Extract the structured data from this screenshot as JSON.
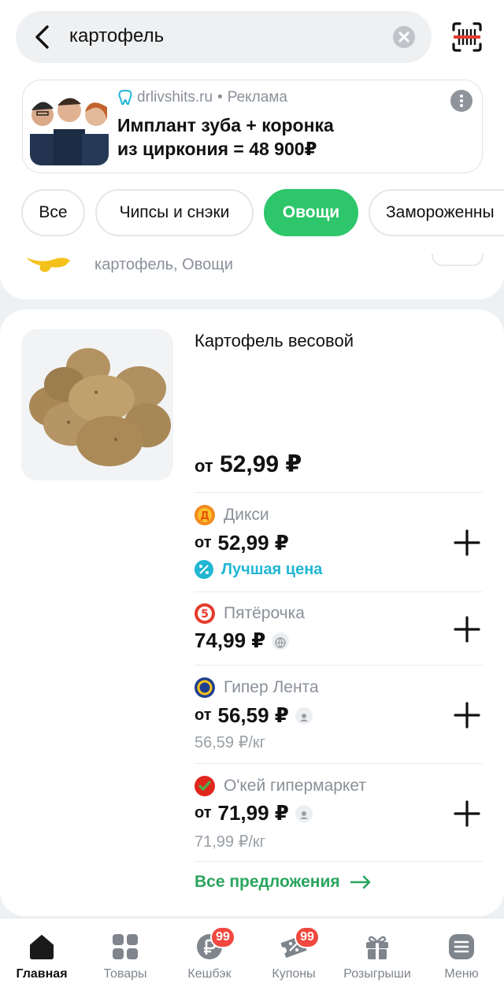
{
  "search": {
    "query": "картофель"
  },
  "ad": {
    "source": "drlivshits.ru",
    "separator": "•",
    "label": "Реклама",
    "title_line1": "Имплант зуба + коронка",
    "title_line2": "из циркония = 48 900₽"
  },
  "chips": [
    {
      "label": "Все",
      "active": false
    },
    {
      "label": "Чипсы и снэки",
      "active": false
    },
    {
      "label": "Овощи",
      "active": true
    },
    {
      "label": "Замороженны",
      "active": false
    }
  ],
  "peek": {
    "text": "картофель, Овощи"
  },
  "product": {
    "title": "Картофель весовой",
    "price_prefix": "от",
    "price": "52,99 ₽"
  },
  "offers": [
    {
      "store": "Дикси",
      "prefix": "от",
      "price": "52,99 ₽",
      "best_label": "Лучшая цена",
      "color": "#f28a1f"
    },
    {
      "store": "Пятёрочка",
      "prefix": "",
      "price": "74,99 ₽",
      "color": "#e33b2c"
    },
    {
      "store": "Гипер Лента",
      "prefix": "от",
      "price": "56,59 ₽",
      "per_kg": "56,59 ₽/кг",
      "color": "#1f3f8f"
    },
    {
      "store": "О'кей гипермаркет",
      "prefix": "от",
      "price": "71,99 ₽",
      "per_kg": "71,99 ₽/кг",
      "color": "#e1261c"
    }
  ],
  "all_offers_label": "Все предложения",
  "nav": {
    "items": [
      {
        "label": "Главная",
        "active": true
      },
      {
        "label": "Товары"
      },
      {
        "label": "Кешбэк",
        "badge": "99"
      },
      {
        "label": "Купоны",
        "badge": "99"
      },
      {
        "label": "Розыгрыши"
      },
      {
        "label": "Меню"
      }
    ]
  },
  "colors": {
    "accent_green": "#2ec66a",
    "best_price": "#21b6d4",
    "badge_red": "#f0483e"
  }
}
